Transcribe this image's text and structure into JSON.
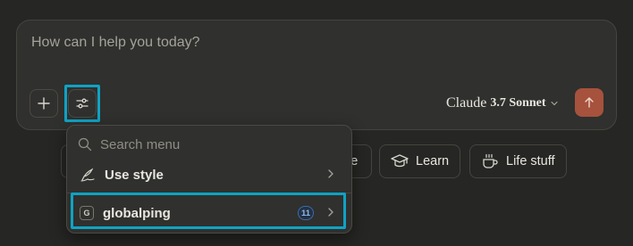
{
  "composer": {
    "placeholder": "How can I help you today?",
    "model_name": "Claude",
    "model_version": "3.7 Sonnet"
  },
  "chips": [
    {
      "label": "ce",
      "icon": "none"
    },
    {
      "label": "Learn",
      "icon": "graduation-cap-icon"
    },
    {
      "label": "Life stuff",
      "icon": "coffee-cup-icon"
    }
  ],
  "menu": {
    "search_placeholder": "Search menu",
    "items": [
      {
        "label": "Use style",
        "icon": "pen-style-icon"
      },
      {
        "label": "globalping",
        "icon_letter": "G",
        "badge": "11"
      }
    ]
  },
  "colors": {
    "background": "#262624",
    "surface": "#30302e",
    "accent_send": "#a6523d",
    "highlight": "#0fa3c4",
    "badge_blue": "#3a6ea8"
  }
}
